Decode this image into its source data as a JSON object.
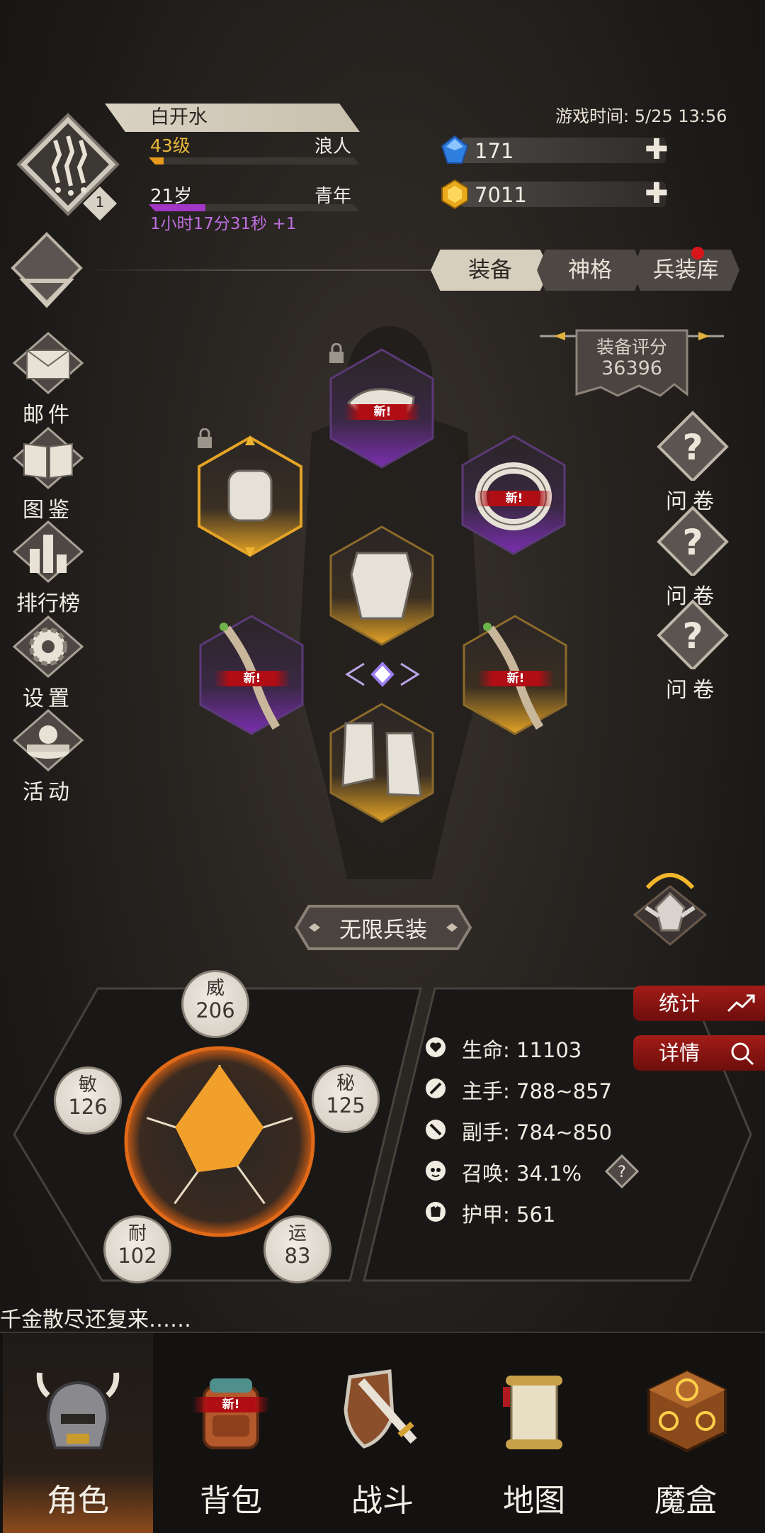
{
  "player": {
    "name": "白开水",
    "level": "43级",
    "class": "浪人",
    "level_progress": 0.07,
    "age": "21岁",
    "life_stage": "青年",
    "age_progress": 0.27,
    "timer": "1小时17分31秒 +1",
    "emblem_badge": "1"
  },
  "game_time": "游戏时间: 5/25 13:56",
  "currency": {
    "gems": "171",
    "gold": "7011"
  },
  "tabs": [
    {
      "label": "装备"
    },
    {
      "label": "神格"
    },
    {
      "label": "兵装库"
    }
  ],
  "score": {
    "label": "装备评分",
    "value": "36396"
  },
  "left_nav": [
    {
      "label": "邮件",
      "icon": "mail-icon"
    },
    {
      "label": "图鉴",
      "icon": "book-icon"
    },
    {
      "label": "排行榜",
      "icon": "ranking-icon"
    },
    {
      "label": "设置",
      "icon": "gear-icon"
    },
    {
      "label": "活动",
      "icon": "event-icon"
    }
  ],
  "surveys": [
    {
      "label": "问卷"
    },
    {
      "label": "问卷"
    },
    {
      "label": "问卷"
    }
  ],
  "equipment": {
    "new_label": "新!",
    "infinite_button": "无限兵装"
  },
  "attributes": [
    {
      "name": "威",
      "value": "206"
    },
    {
      "name": "秘",
      "value": "125"
    },
    {
      "name": "运",
      "value": "83"
    },
    {
      "name": "耐",
      "value": "102"
    },
    {
      "name": "敏",
      "value": "126"
    }
  ],
  "stats": [
    {
      "label": "生命: 11103",
      "icon": "heart-icon"
    },
    {
      "label": "主手: 788~857",
      "icon": "sword-icon"
    },
    {
      "label": "副手: 784~850",
      "icon": "dagger-icon"
    },
    {
      "label": "召唤: 34.1%",
      "icon": "summon-icon"
    },
    {
      "label": "护甲: 561",
      "icon": "armor-icon"
    }
  ],
  "side_buttons": {
    "stats": "统计",
    "details": "详情"
  },
  "ticker": "千金散尽还复来……",
  "bottom_nav": [
    {
      "label": "角色"
    },
    {
      "label": "背包"
    },
    {
      "label": "战斗"
    },
    {
      "label": "地图"
    },
    {
      "label": "魔盒"
    }
  ],
  "colors": {
    "level_bar": "#e79a1c",
    "age_bar": "#a236c6",
    "rare": "#6a2a9e",
    "legendary": "#e4a326",
    "accent_red": "#a31c18"
  }
}
